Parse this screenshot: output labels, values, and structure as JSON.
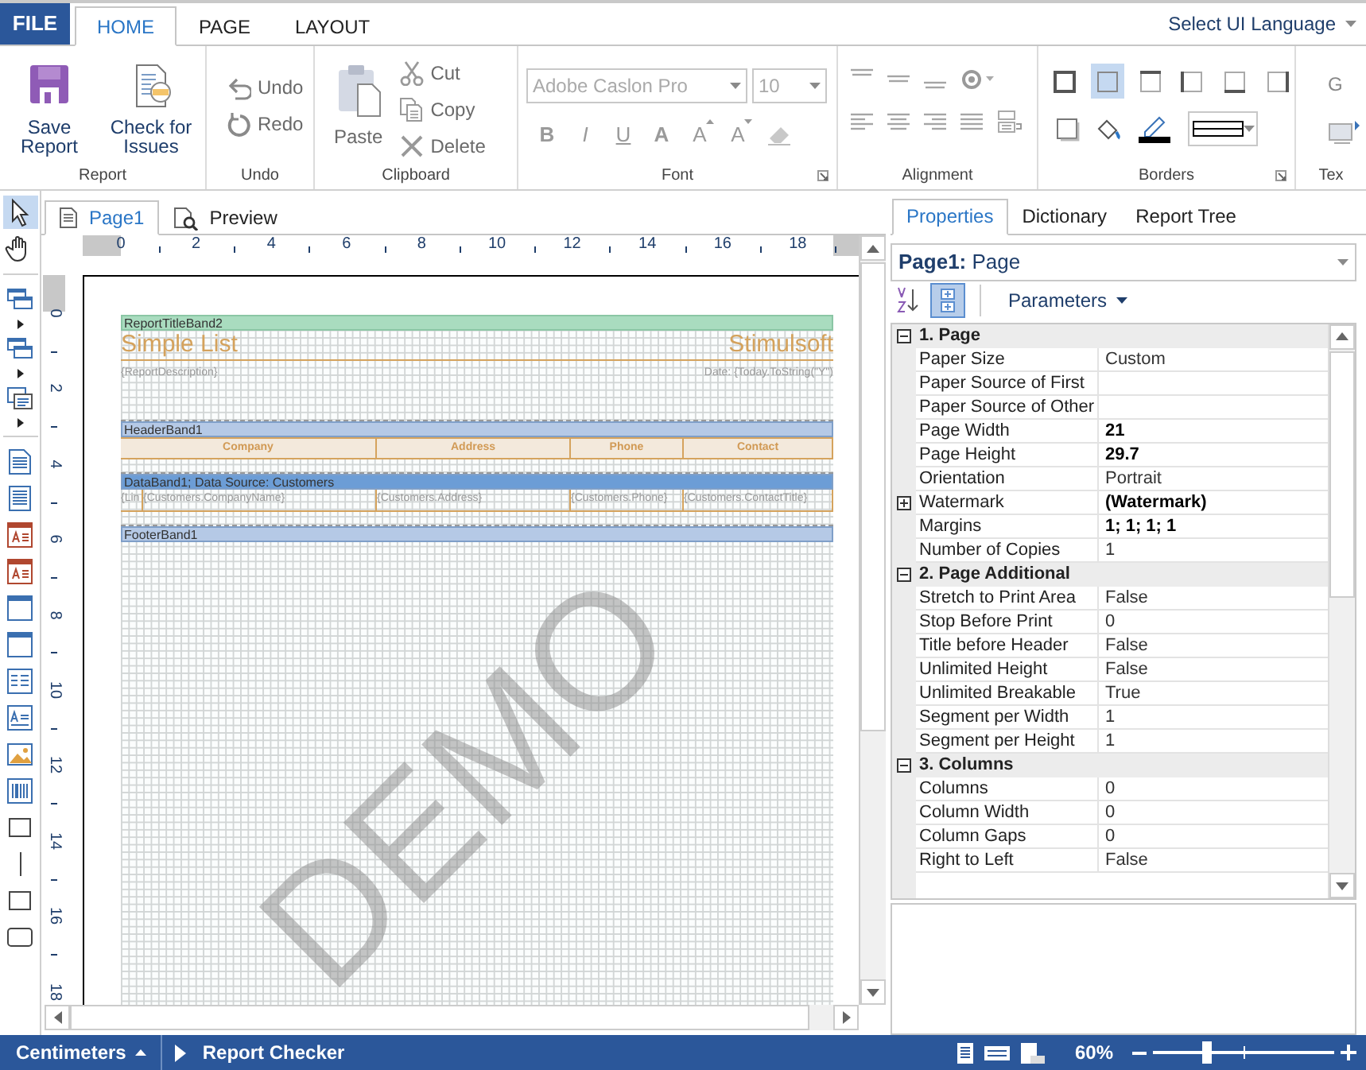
{
  "menu_tabs": [
    {
      "label": "FILE",
      "kind": "file",
      "selected": false
    },
    {
      "label": "HOME",
      "kind": "tab",
      "selected": true
    },
    {
      "label": "PAGE",
      "kind": "tab",
      "selected": false
    },
    {
      "label": "LAYOUT",
      "kind": "tab",
      "selected": false
    }
  ],
  "language_menu": "Select UI Language",
  "ribbon": {
    "report": {
      "label": "Report",
      "buttons": [
        {
          "kind": "save",
          "label": "Save Report",
          "disabled": false
        },
        {
          "kind": "check",
          "label": "Check for Issues",
          "disabled": false
        }
      ]
    },
    "undo": {
      "label": "Undo",
      "buttons": [
        {
          "kind": "undo",
          "label": "Undo",
          "disabled": true
        },
        {
          "kind": "redo",
          "label": "Redo",
          "disabled": true
        }
      ]
    },
    "clipboard": {
      "label": "Clipboard",
      "buttons": [
        {
          "kind": "paste",
          "label": "Paste",
          "disabled": true
        },
        {
          "kind": "cut",
          "label": "Cut",
          "disabled": true
        },
        {
          "kind": "copy",
          "label": "Copy",
          "disabled": true
        },
        {
          "kind": "delete",
          "label": "Delete",
          "disabled": true
        }
      ]
    },
    "font": {
      "label": "Font",
      "font_name": "Adobe Caslon Pro",
      "font_size": "10",
      "buttons": [
        {
          "kind": "bold",
          "label": "B"
        },
        {
          "kind": "italic",
          "label": "I"
        },
        {
          "kind": "underline",
          "label": "U"
        },
        {
          "kind": "color",
          "label": "A"
        },
        {
          "kind": "grow",
          "label": "A"
        },
        {
          "kind": "shrink",
          "label": "A"
        }
      ]
    },
    "alignment": {
      "label": "Alignment"
    },
    "borders": {
      "label": "Borders",
      "buttons": [
        {
          "kind": "all",
          "selected": false
        },
        {
          "kind": "none",
          "selected": true
        },
        {
          "kind": "top",
          "selected": false
        },
        {
          "kind": "left",
          "selected": false
        },
        {
          "kind": "bottom",
          "selected": false
        },
        {
          "kind": "right",
          "selected": false
        }
      ]
    },
    "text": {
      "label": "Tex",
      "button": "G"
    }
  },
  "toolbox": [
    {
      "kind": "pointer",
      "selected": true
    },
    {
      "kind": "hand",
      "selected": false
    },
    {
      "kind": "separator"
    },
    {
      "kind": "bands",
      "selected": false
    },
    {
      "kind": "arrow"
    },
    {
      "kind": "bands",
      "selected": false
    },
    {
      "kind": "arrow"
    },
    {
      "kind": "cross",
      "selected": false
    },
    {
      "kind": "arrow"
    },
    {
      "kind": "separator"
    },
    {
      "kind": "page",
      "selected": false
    },
    {
      "kind": "lines",
      "selected": false
    },
    {
      "kind": "text",
      "selected": false
    },
    {
      "kind": "text",
      "selected": false
    },
    {
      "kind": "panel",
      "selected": false
    },
    {
      "kind": "panel",
      "selected": false
    },
    {
      "kind": "checks",
      "selected": false
    },
    {
      "kind": "label",
      "selected": false
    },
    {
      "kind": "image",
      "selected": false
    },
    {
      "kind": "barcode",
      "selected": false
    },
    {
      "kind": "rect",
      "selected": false
    },
    {
      "kind": "line",
      "selected": false
    },
    {
      "kind": "rect",
      "selected": false
    },
    {
      "kind": "roundrect",
      "selected": false
    }
  ],
  "designer_tabs": [
    {
      "label": "Page1",
      "kind": "page",
      "selected": true
    },
    {
      "label": "Preview",
      "kind": "preview",
      "selected": false
    }
  ],
  "h_ruler": [
    "0",
    "2",
    "4",
    "6",
    "8",
    "10",
    "12",
    "14",
    "16",
    "18"
  ],
  "v_ruler": [
    "0",
    "2",
    "4",
    "6",
    "8",
    "10",
    "12",
    "14",
    "16",
    "18"
  ],
  "report": {
    "bands": [
      {
        "kind": "title",
        "name": "ReportTitleBand2",
        "title": "Simple List",
        "company": "Stimulsoft",
        "description": "{ReportDescription}",
        "date": "Date: {Today.ToString(\"Y\")"
      },
      {
        "kind": "header",
        "name": "HeaderBand1",
        "cells": [
          "Company",
          "Address",
          "Phone",
          "Contact"
        ]
      },
      {
        "kind": "data",
        "name": "DataBand1; Data Source: Customers",
        "cells": [
          "{Lin",
          "{Customers.CompanyName}",
          "{Customers.Address}",
          "{Customers.Phone}",
          "{Customers.ContactTitle}"
        ]
      },
      {
        "kind": "footer",
        "name": "FooterBand1"
      }
    ],
    "demo_watermark": "DEMO"
  },
  "properties_panel": {
    "tabs": [
      {
        "label": "Properties",
        "selected": true
      },
      {
        "label": "Dictionary",
        "selected": false
      },
      {
        "label": "Report Tree",
        "selected": false
      }
    ],
    "object_selector": "**Page1:** Page",
    "sort_buttons": [
      {
        "kind": "alphabetical",
        "selected": false
      },
      {
        "kind": "categorized",
        "selected": true
      }
    ],
    "parameters_button": "Parameters",
    "categories": [
      {
        "name": "1. Page",
        "expanded": true,
        "rows": [
          {
            "name": "Paper Size",
            "value": "Custom",
            "modified": false
          },
          {
            "name": "Paper Source of First"
          },
          {
            "name": "Paper Source of Other"
          },
          {
            "name": "Page Width",
            "value": "21",
            "modified": true
          },
          {
            "name": "Page Height",
            "value": "29.7",
            "modified": true
          },
          {
            "name": "Orientation",
            "value": "Portrait",
            "modified": false
          },
          {
            "name": "Watermark",
            "value": "(Watermark)",
            "modified": true,
            "expanded": false
          },
          {
            "name": "Margins",
            "value": "1; 1; 1; 1",
            "modified": true
          },
          {
            "name": "Number of Copies",
            "value": "1",
            "modified": false
          }
        ]
      },
      {
        "name": "2. Page Additional",
        "expanded": true,
        "rows": [
          {
            "name": "Stretch to Print Area",
            "value": "False",
            "modified": false
          },
          {
            "name": "Stop Before Print",
            "value": "0",
            "modified": false
          },
          {
            "name": "Title before Header",
            "value": "False",
            "modified": false
          },
          {
            "name": "Unlimited Height",
            "value": "False",
            "modified": false
          },
          {
            "name": "Unlimited Breakable",
            "value": "True",
            "modified": false
          },
          {
            "name": "Segment per Width",
            "value": "1",
            "modified": false
          },
          {
            "name": "Segment per Height",
            "value": "1",
            "modified": false
          }
        ]
      },
      {
        "name": "3. Columns",
        "expanded": true,
        "rows": [
          {
            "name": "Columns",
            "value": "0",
            "modified": false
          },
          {
            "name": "Column Width",
            "value": "0",
            "modified": false
          },
          {
            "name": "Column Gaps",
            "value": "0",
            "modified": false
          },
          {
            "name": "Right to Left",
            "value": "False",
            "modified": false
          }
        ]
      }
    ]
  },
  "status_bar": {
    "units": "Centimeters",
    "report_checker": "Report Checker",
    "zoom": "60%",
    "zoom_slider": {
      "level": 0.3
    }
  }
}
